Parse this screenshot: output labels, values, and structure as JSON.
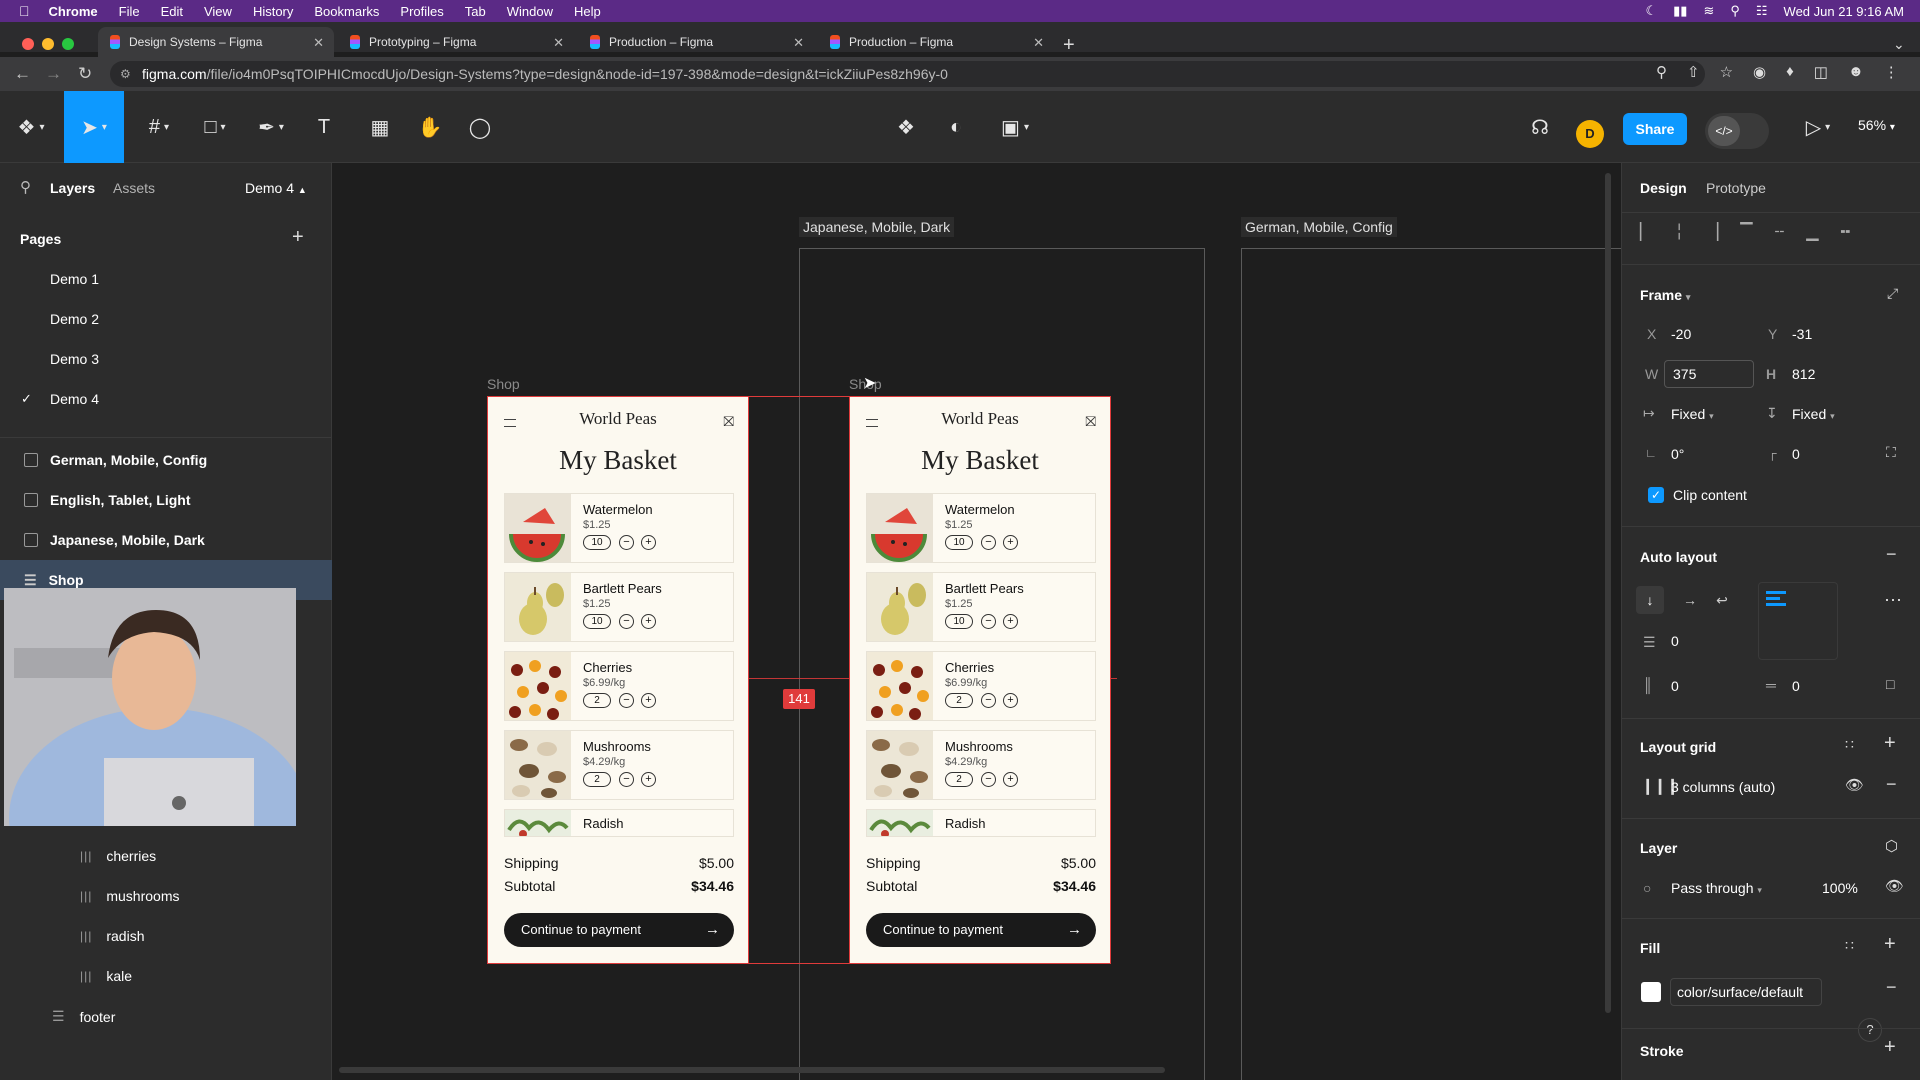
{
  "menubar": {
    "items": [
      "Chrome",
      "File",
      "Edit",
      "View",
      "History",
      "Bookmarks",
      "Profiles",
      "Tab",
      "Window",
      "Help"
    ],
    "datetime": "Wed Jun 21  9:16 AM"
  },
  "tabs": [
    {
      "title": "Design Systems – Figma"
    },
    {
      "title": "Prototyping – Figma"
    },
    {
      "title": "Production – Figma"
    },
    {
      "title": "Production – Figma"
    }
  ],
  "address": {
    "domain": "figma.com",
    "path": "/file/io4m0PsqTOIPHICmocdUjo/Design-Systems?type=design&node-id=197-398&mode=design&t=ickZiiuPes8zh96y-0"
  },
  "toolbar": {
    "avatar_letter": "D",
    "share_label": "Share",
    "zoom": "56%"
  },
  "left_panel": {
    "tabs": {
      "layers": "Layers",
      "assets": "Assets"
    },
    "page_selector": "Demo 4",
    "pages_title": "Pages",
    "pages": [
      "Demo 1",
      "Demo 2",
      "Demo 3",
      "Demo 4"
    ],
    "frames": [
      "German, Mobile, Config",
      "English, Tablet, Light",
      "Japanese, Mobile, Dark",
      "Shop"
    ],
    "children": [
      "cherries",
      "mushrooms",
      "radish",
      "kale"
    ],
    "footer": "footer"
  },
  "canvas": {
    "frame_labels": [
      "Japanese, Mobile, Dark",
      "German, Mobile, Config"
    ],
    "shop_label_left": "Shop",
    "shop_label_right": "Shop",
    "measure": "141",
    "phone": {
      "brand": "World Peas",
      "title": "My Basket",
      "items": [
        {
          "name": "Watermelon",
          "price": "$1.25",
          "qty": "10"
        },
        {
          "name": "Bartlett Pears",
          "price": "$1.25",
          "qty": "10"
        },
        {
          "name": "Cherries",
          "price": "$6.99/kg",
          "qty": "2"
        },
        {
          "name": "Mushrooms",
          "price": "$4.29/kg",
          "qty": "2"
        },
        {
          "name": "Radish",
          "price": "",
          "qty": ""
        }
      ],
      "shipping_label": "Shipping",
      "shipping_value": "$5.00",
      "subtotal_label": "Subtotal",
      "subtotal_value": "$34.46",
      "cta": "Continue to payment"
    }
  },
  "right_panel": {
    "tabs": {
      "design": "Design",
      "prototype": "Prototype"
    },
    "frame_title": "Frame",
    "x_label": "X",
    "x": "-20",
    "y_label": "Y",
    "y": "-31",
    "w_label": "W",
    "w": "375",
    "h_label": "H",
    "h": "812",
    "hres": "Fixed",
    "vres": "Fixed",
    "rotation": "0°",
    "radius": "0",
    "clip_content": "Clip content",
    "auto_layout_title": "Auto layout",
    "gap": "0",
    "pad_h": "0",
    "pad_v": "0",
    "layout_grid_title": "Layout grid",
    "grid_value": "3 columns (auto)",
    "layer_title": "Layer",
    "blend": "Pass through",
    "opacity": "100%",
    "fill_title": "Fill",
    "fill_token": "color/surface/default",
    "stroke_title": "Stroke"
  }
}
